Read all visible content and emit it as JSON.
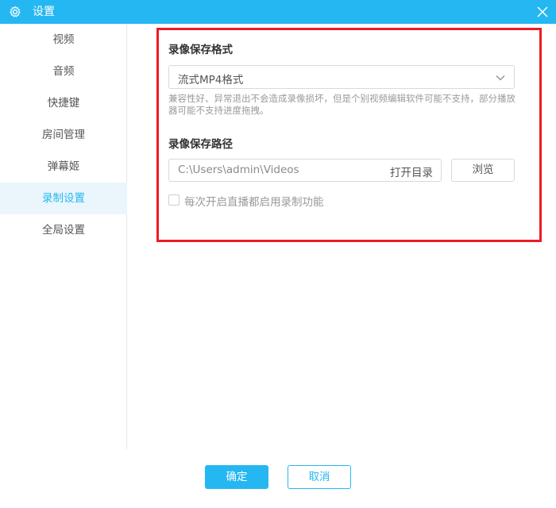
{
  "window": {
    "title": "设置",
    "icon": "gear-icon",
    "close_icon": "close-icon"
  },
  "sidebar": {
    "items": [
      {
        "label": "视频"
      },
      {
        "label": "音频"
      },
      {
        "label": "快捷键"
      },
      {
        "label": "房间管理"
      },
      {
        "label": "弹幕姬"
      },
      {
        "label": "录制设置",
        "active": true
      },
      {
        "label": "全局设置"
      }
    ]
  },
  "record": {
    "format_label": "录像保存格式",
    "format_value": "流式MP4格式",
    "format_hint": "兼容性好、异常退出不会造成录像损坏，但是个别视频编辑软件可能不支持，部分播放器可能不支持进度拖拽。",
    "path_label": "录像保存路径",
    "path_value": "C:\\Users\\admin\\Videos",
    "open_dir_label": "打开目录",
    "browse_label": "浏览",
    "auto_record_label": "每次开启直播都启用录制功能",
    "auto_record_checked": false
  },
  "footer": {
    "ok_label": "确定",
    "cancel_label": "取消"
  },
  "colors": {
    "accent": "#25b7f2",
    "highlight_border": "#ec1c24"
  }
}
